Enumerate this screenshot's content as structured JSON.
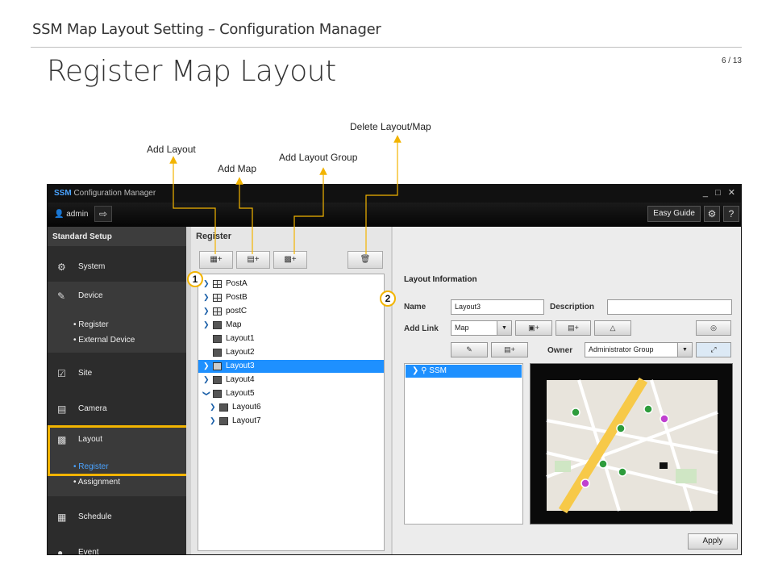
{
  "slide": {
    "header": "SSM Map Layout Setting – Configuration Manager",
    "title": "Register Map Layout",
    "page": "6 / 13"
  },
  "callouts": {
    "add_layout": "Add Layout",
    "add_map": "Add Map",
    "add_layout_group": "Add Layout Group",
    "delete_layout_map": "Delete Layout/Map",
    "badge_1": "1",
    "badge_2": "2"
  },
  "app": {
    "title_brand": "SSM",
    "title_rest": " Configuration Manager",
    "window_controls": "_ □ ✕",
    "user": "admin",
    "easy_guide": "Easy Guide",
    "help": "?"
  },
  "sidebar": {
    "header": "Standard Setup",
    "items": [
      {
        "label": "System",
        "icon": "system-icon"
      },
      {
        "label": "Device",
        "icon": "device-icon"
      },
      {
        "label": "Site",
        "icon": "site-icon"
      },
      {
        "label": "Camera",
        "icon": "camera-icon"
      },
      {
        "label": "Layout",
        "icon": "layout-icon"
      },
      {
        "label": "Schedule",
        "icon": "schedule-icon"
      },
      {
        "label": "Event",
        "icon": "event-icon"
      }
    ],
    "device_sub": [
      "Register",
      "External Device"
    ],
    "layout_sub": [
      "Register",
      "Assignment"
    ]
  },
  "register": {
    "title": "Register",
    "tree": [
      {
        "label": "PostA",
        "type": "group",
        "indent": 0
      },
      {
        "label": "PostB",
        "type": "group",
        "indent": 0
      },
      {
        "label": "postC",
        "type": "group",
        "indent": 0
      },
      {
        "label": "Map",
        "type": "map",
        "indent": 0
      },
      {
        "label": "Layout1",
        "type": "layout",
        "indent": 0
      },
      {
        "label": "Layout2",
        "type": "layout",
        "indent": 0
      },
      {
        "label": "Layout3",
        "type": "layout",
        "indent": 0,
        "selected": true
      },
      {
        "label": "Layout4",
        "type": "layout",
        "indent": 0
      },
      {
        "label": "Layout5",
        "type": "layout",
        "indent": 0,
        "expanded": true
      },
      {
        "label": "Layout6",
        "type": "layout",
        "indent": 1
      },
      {
        "label": "Layout7",
        "type": "layout",
        "indent": 1
      }
    ]
  },
  "layout_info": {
    "title": "Layout Information",
    "name_label": "Name",
    "name_value": "Layout3",
    "description_label": "Description",
    "description_value": "",
    "add_link_label": "Add Link",
    "add_link_value": "Map",
    "owner_label": "Owner",
    "owner_value": "Administrator Group",
    "map_tree_item": "SSM",
    "apply": "Apply"
  },
  "colors": {
    "accent_blue": "#1e90ff",
    "highlight": "#f2b400",
    "dark_bg": "#111111"
  }
}
